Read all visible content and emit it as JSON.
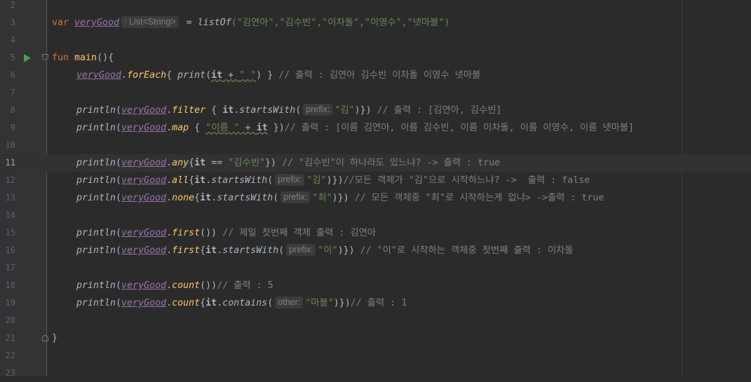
{
  "editor": {
    "colors": {
      "background": "#2b2b2b",
      "keyword": "#cc7832",
      "string": "#6a8759",
      "comment": "#808080",
      "property": "#9876aa",
      "function": "#ffc66d",
      "number": "#6897bb"
    },
    "line_numbers": [
      "2",
      "3",
      "4",
      "5",
      "6",
      "7",
      "8",
      "9",
      "10",
      "11",
      "12",
      "13",
      "14",
      "15",
      "16",
      "17",
      "18",
      "19",
      "20",
      "21",
      "22",
      "23"
    ],
    "current_line": "11",
    "l3": {
      "var": "var ",
      "name": "veryGood",
      "hint": ": List<String>",
      "eq": " = ",
      "fn": "listOf",
      "args": "(\"김연아\",\"김수빈\",\"이차돌\",\"이영수\",\"넷마블\")"
    },
    "l5": {
      "kw": "fun ",
      "name": "main",
      "rest": "(){"
    },
    "l6": {
      "name": "veryGood",
      "dot": ".",
      "fn": "forEach",
      "open": "{ ",
      "print": "print",
      "p1": "(",
      "it": "it",
      "plus": " + ",
      "s": "\" \"",
      "p2": ") } ",
      "cmt": "// 출력 : 김연아 김수빈 이차돌 이영수 넷마블"
    },
    "l8": {
      "println": "println",
      "p": "(",
      "name": "veryGood",
      "dot": ".",
      "fn": "filter",
      "a": " { ",
      "it": "it",
      "dot2": ".",
      "fn2": "startsWith",
      "p2": "(",
      "hint": "prefix:",
      "s": "\"김\"",
      "close": ")}) ",
      "cmt": "// 출력 : [김연아, 김수빈]"
    },
    "l9": {
      "println": "println",
      "p": "(",
      "name": "veryGood",
      "dot": ".",
      "fn": "map",
      "a": " { ",
      "s": "\"이름 \"",
      "plus": " + ",
      "it": "it",
      "close": " })",
      "cmt": "// 출력 : [이름 김연아, 이름 김수빈, 이름 이차돌, 이름 이영수, 이름 넷마블]"
    },
    "l11": {
      "println": "println",
      "p": "(",
      "name": "veryGood",
      "dot": ".",
      "fn": "any",
      "a": "{",
      "it": "it",
      "eq": " == ",
      "s": "\"김수빈\"",
      "close": "}) ",
      "cmt": "// \"김수빈\"이 하나라도 있느냐? -> 출력 : true"
    },
    "l12": {
      "println": "println",
      "p": "(",
      "name": "veryGood",
      "dot": ".",
      "fn": "all",
      "a": "{",
      "it": "it",
      "dot2": ".",
      "fn2": "startsWith",
      "p2": "(",
      "hint": "prefix:",
      "s": "\"김\"",
      "close": ")})",
      "cmt": "//모든 객체가 \"김\"으로 시작하느냐? ->  출력 : false"
    },
    "l13": {
      "println": "println",
      "p": "(",
      "name": "veryGood",
      "dot": ".",
      "fn": "none",
      "a": "{",
      "it": "it",
      "dot2": ".",
      "fn2": "startsWith",
      "p2": "(",
      "hint": "prefix:",
      "s": "\"최\"",
      "close": ")}) ",
      "cmt": "// 모든 객체중 \"최\"로 시작하는게 없냐> ->출력 : true"
    },
    "l15": {
      "println": "println",
      "p": "(",
      "name": "veryGood",
      "dot": ".",
      "fn": "first",
      "close": "()) ",
      "cmt": "// 제일 첫번째 객체 출력 : 김연아"
    },
    "l16": {
      "println": "println",
      "p": "(",
      "name": "veryGood",
      "dot": ".",
      "fn": "first",
      "a": "{",
      "it": "it",
      "dot2": ".",
      "fn2": "startsWith",
      "p2": "(",
      "hint": "prefix:",
      "s": "\"이\"",
      "close": ")}) ",
      "cmt": "// \"이\"로 시작하는 객체중 첫번째 출력 : 이차돌"
    },
    "l18": {
      "println": "println",
      "p": "(",
      "name": "veryGood",
      "dot": ".",
      "fn": "count",
      "close": "())",
      "cmt": "// 출력 : 5"
    },
    "l19": {
      "println": "println",
      "p": "(",
      "name": "veryGood",
      "dot": ".",
      "fn": "count",
      "a": "{",
      "it": "it",
      "dot2": ".",
      "fn2": "contains",
      "p2": "(",
      "hint": "other:",
      "s": "\"마블\"",
      "close": ")})",
      "cmt": "// 출력 : 1"
    },
    "l21": {
      "brace": "}"
    }
  }
}
